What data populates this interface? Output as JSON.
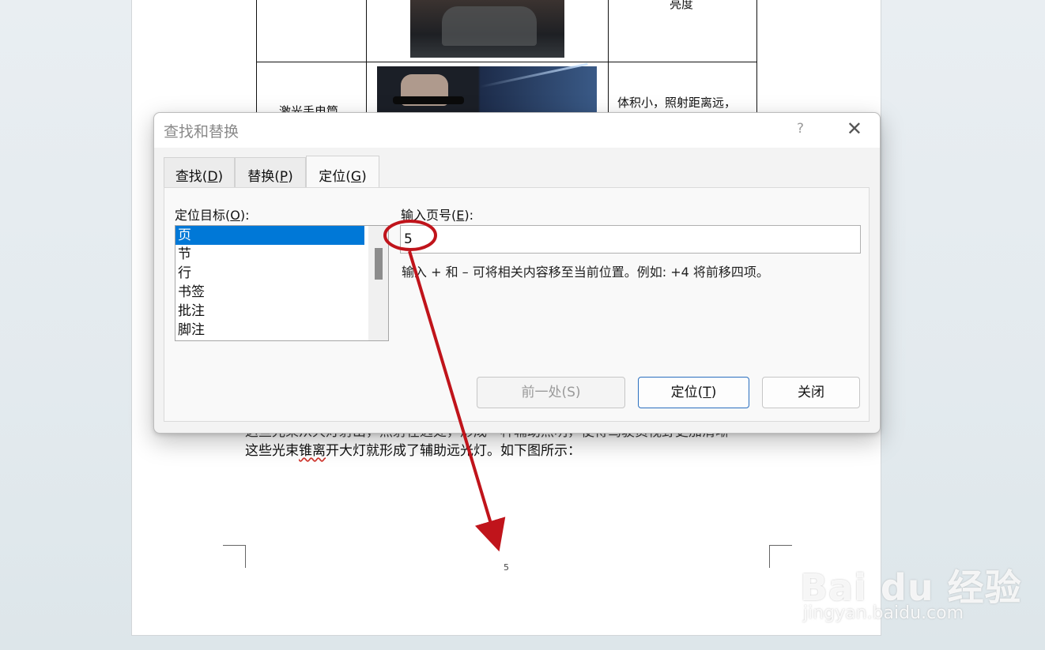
{
  "document": {
    "table": {
      "row1_right": "亮度",
      "row2_left": "激光手电筒",
      "row2_right": "体积小，照射距离远，"
    },
    "line_faded": "这些光束从大灯射出，照射在远处，形成一种辅助照明，使得驾驶员视野更加清晰",
    "line1_a": "这些光束",
    "line1_spell": "锥离",
    "line1_b": "开大灯就形成了辅助远光灯。如下图所示：",
    "page_number": "5"
  },
  "dialog": {
    "title": "查找和替换",
    "help_symbol": "?",
    "close_symbol": "✕",
    "tabs": [
      {
        "label_pre": "查找(",
        "key": "D",
        "label_post": ")"
      },
      {
        "label_pre": "替换(",
        "key": "P",
        "label_post": ")"
      },
      {
        "label_pre": "定位(",
        "key": "G",
        "label_post": ")"
      }
    ],
    "goto_label_pre": "定位目标(",
    "goto_label_key": "O",
    "goto_label_post": "):",
    "goto_items": [
      "页",
      "节",
      "行",
      "书签",
      "批注",
      "脚注"
    ],
    "selected_item": "页",
    "page_label_pre": "输入页号(",
    "page_label_key": "E",
    "page_label_post": "):",
    "page_value": "5",
    "hint": "输入 + 和 – 可将相关内容移至当前位置。例如: +4 将前移四项。",
    "buttons": {
      "previous": "前一处(S)",
      "goto_pre": "定位(",
      "goto_key": "T",
      "goto_post": ")",
      "close": "关闭"
    }
  },
  "annotation": {
    "color": "#c0141b"
  },
  "watermark": {
    "main": "Bai du 经验",
    "sub": "jingyan.baidu.com"
  }
}
